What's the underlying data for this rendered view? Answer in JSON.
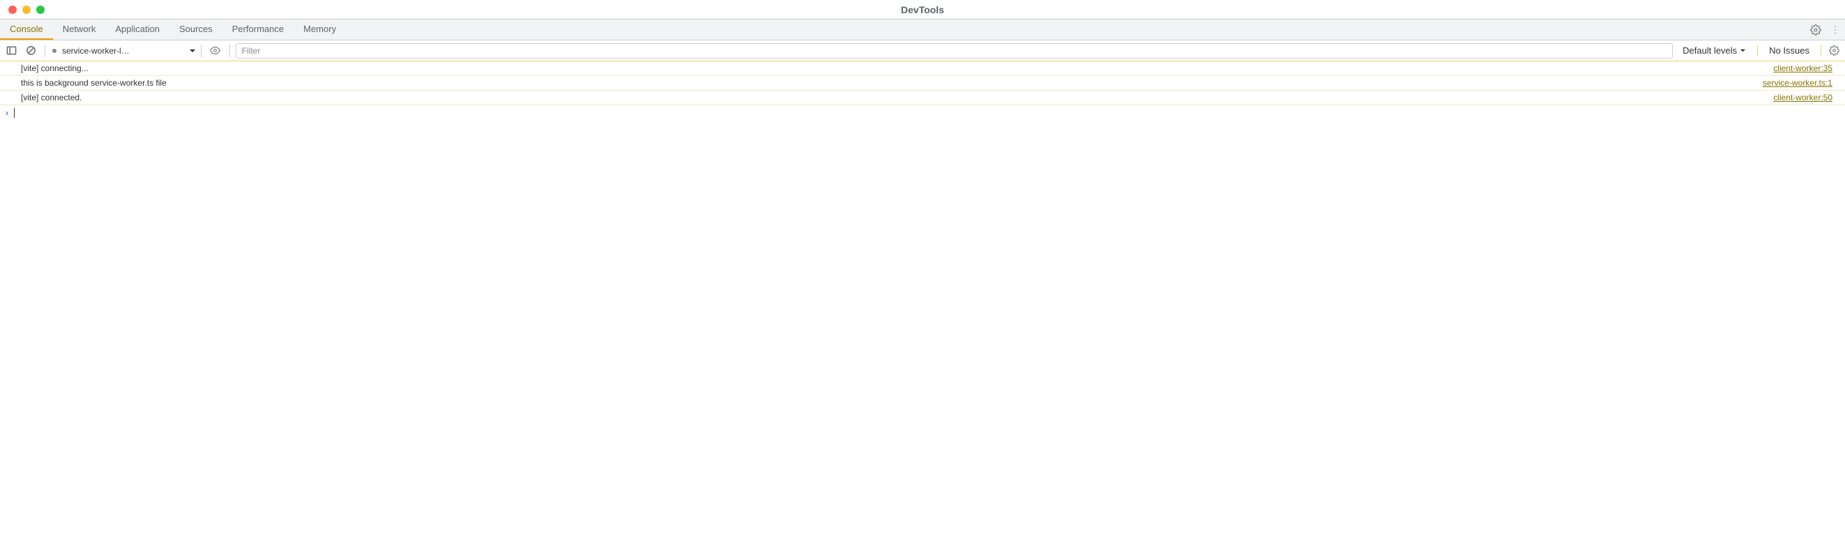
{
  "title": "DevTools",
  "tabs": [
    "Console",
    "Network",
    "Application",
    "Sources",
    "Performance",
    "Memory"
  ],
  "active_tab": 0,
  "toolbar": {
    "context": "service-worker-l…",
    "filter_placeholder": "Filter",
    "levels": "Default levels",
    "issues": "No Issues"
  },
  "messages": [
    {
      "text": "[vite] connecting...",
      "source": "client-worker:35",
      "highlight": false
    },
    {
      "text": "this is background service-worker.ts file",
      "source": "service-worker.ts:1",
      "highlight": true
    },
    {
      "text": "[vite] connected.",
      "source": "client-worker:50",
      "highlight": false
    }
  ]
}
